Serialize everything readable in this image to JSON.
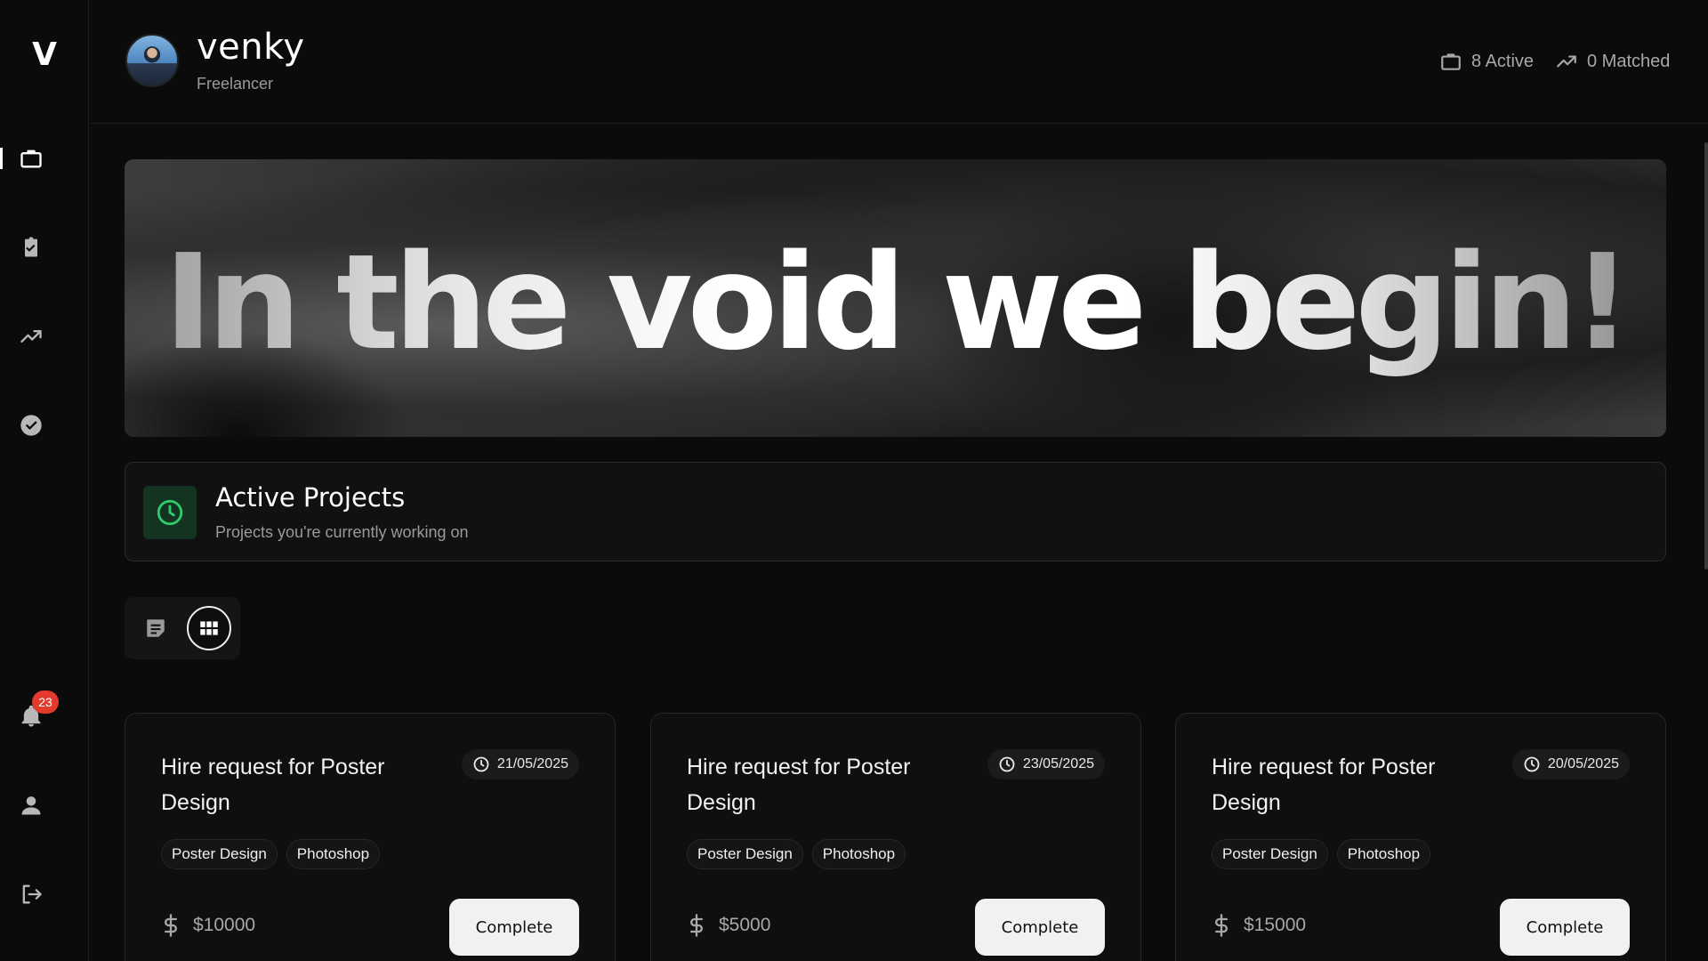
{
  "brand": {
    "logo_text": "V"
  },
  "sidebar": {
    "items": [
      {
        "icon": "briefcase-icon",
        "active": true
      },
      {
        "icon": "clipboard-check-icon",
        "active": false
      },
      {
        "icon": "trending-up-icon",
        "active": false
      },
      {
        "icon": "check-circle-icon",
        "active": false
      }
    ],
    "bottom": [
      {
        "icon": "bell-icon",
        "badge": "23"
      },
      {
        "icon": "user-icon"
      },
      {
        "icon": "logout-icon"
      }
    ]
  },
  "header": {
    "username": "venky",
    "role": "Freelancer",
    "active_stat": "8 Active",
    "matched_stat": "0 Matched"
  },
  "hero": {
    "title": "In the void we begin!"
  },
  "panel": {
    "title": "Active Projects",
    "subtitle": "Projects you're currently working on"
  },
  "view_toggle": {
    "selected": "grid"
  },
  "cards": [
    {
      "title": "Hire request for Poster Design",
      "date": "21/05/2025",
      "tags": [
        "Poster Design",
        "Photoshop"
      ],
      "price": "$10000",
      "button": "Complete"
    },
    {
      "title": "Hire request for Poster Design",
      "date": "23/05/2025",
      "tags": [
        "Poster Design",
        "Photoshop"
      ],
      "price": "$5000",
      "button": "Complete"
    },
    {
      "title": "Hire request for Poster Design",
      "date": "20/05/2025",
      "tags": [
        "Poster Design",
        "Photoshop"
      ],
      "price": "$15000",
      "button": "Complete"
    }
  ],
  "colors": {
    "background": "#0b0b0b",
    "accent_green": "#2ecc71",
    "badge_red": "#e23b2e",
    "button_bg": "#f1f1f1"
  }
}
